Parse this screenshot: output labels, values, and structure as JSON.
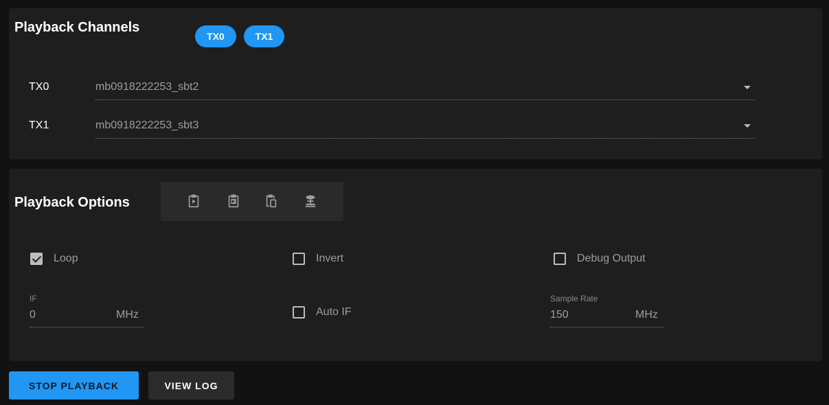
{
  "channels": {
    "title": "Playback Channels",
    "chips": [
      {
        "label": "TX0"
      },
      {
        "label": "TX1"
      }
    ],
    "rows": [
      {
        "label": "TX0",
        "value": "mb0918222253_sbt2"
      },
      {
        "label": "TX1",
        "value": "mb0918222253_sbt3"
      }
    ]
  },
  "options": {
    "title": "Playback Options",
    "toolbar_icons": [
      "clipboard-play-icon",
      "clipboard-arrow-left-icon",
      "clipboard-copy-icon",
      "radio-tower-icon"
    ],
    "checkboxes": {
      "loop": {
        "label": "Loop",
        "checked": true
      },
      "invert": {
        "label": "Invert",
        "checked": false
      },
      "debug": {
        "label": "Debug Output",
        "checked": false
      },
      "auto_if": {
        "label": "Auto IF",
        "checked": false
      }
    },
    "if_field": {
      "caption": "IF",
      "value": "0",
      "unit": "MHz"
    },
    "sample_rate": {
      "caption": "Sample Rate",
      "value": "150",
      "unit": "MHz"
    }
  },
  "actions": {
    "stop_label": "STOP PLAYBACK",
    "log_label": "VIEW LOG"
  },
  "colors": {
    "accent": "#2196f3",
    "background": "#121212",
    "card": "#1e1e1e"
  }
}
